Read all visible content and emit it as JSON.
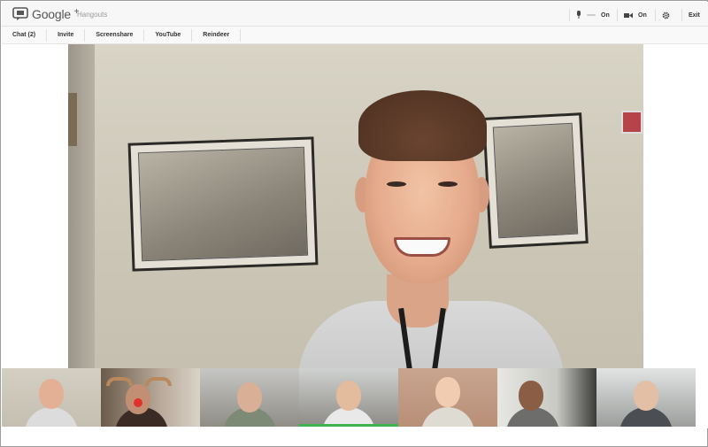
{
  "window": {
    "brand": "Google",
    "brand_plus": "+",
    "app_name": "Hangouts"
  },
  "controls": {
    "mic_state": "On",
    "camera_state": "On",
    "exit_label": "Exit"
  },
  "toolbar": {
    "items": [
      "Chat (2)",
      "Invite",
      "Screenshare",
      "YouTube",
      "Reindeer"
    ]
  },
  "participants": {
    "selected_index": 0,
    "speaking_index": 3,
    "count": 7
  },
  "colors": {
    "selected_outline": "#4d90fe",
    "speaking_bar": "#3fb34f"
  },
  "icons": {
    "logo": "hangouts-bubble-icon",
    "mic": "microphone-icon",
    "camera": "video-camera-icon",
    "settings": "gear-icon"
  }
}
